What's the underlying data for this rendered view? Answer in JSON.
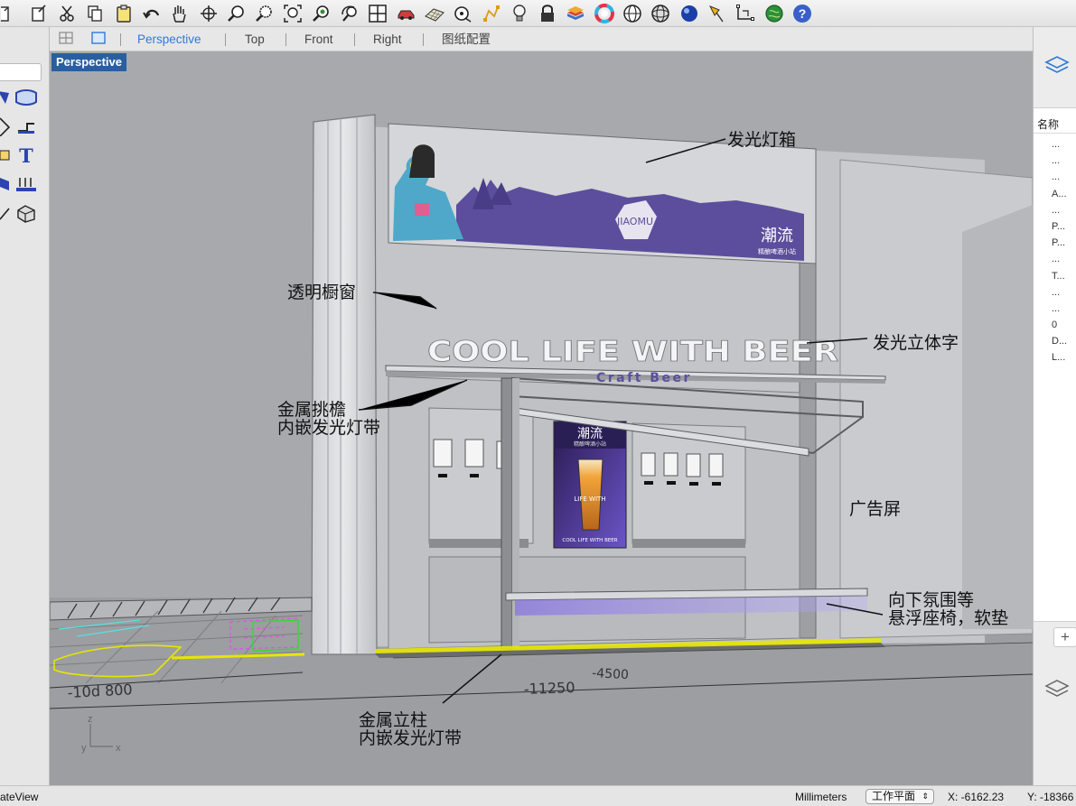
{
  "toolbar": {
    "icons": [
      "page-icon",
      "new-doc-icon",
      "cut-icon",
      "copy-icon",
      "paste-icon",
      "undo-icon",
      "pan-hand-icon",
      "rotate-view-icon",
      "zoom-icon",
      "zoom-window-icon",
      "zoom-extents-icon",
      "zoom-selected-icon",
      "rotate-camera-icon",
      "four-viewports-icon",
      "car-icon",
      "grid-plane-icon",
      "target-icon",
      "points-icon",
      "light-bulb-icon",
      "lock-icon",
      "layers-book-icon",
      "color-wheel-icon",
      "sphere-wire-icon",
      "mesh-sphere-icon",
      "render-sphere-icon",
      "pen-icon",
      "gumball-icon",
      "globe-icon",
      "help-icon"
    ]
  },
  "view_tabs": {
    "items": [
      "Perspective",
      "Top",
      "Front",
      "Right",
      "图纸配置"
    ],
    "active": "Perspective"
  },
  "viewport": {
    "label": "Perspective",
    "axis": {
      "z": "z",
      "y": "y",
      "x": "x"
    },
    "dimensions": [
      "-10d 800",
      "-4500",
      "-11250"
    ]
  },
  "scene": {
    "logo_text": "潮流",
    "logo_subtext": "精酿啤酒小站",
    "emblem_text": "JIAOMU",
    "headline": "COOL LIFE WITH BEER",
    "subline": "Craft Beer",
    "screen_logo": "潮流",
    "screen_sub": "精酿啤酒小站",
    "screen_mid": "LIFE WITH",
    "screen_bottom": "COOL LIFE WITH BEER"
  },
  "annotations": {
    "lightbox": "发光灯箱",
    "window": "透明橱窗",
    "letters": "发光立体字",
    "canopy_1": "金属挑檐",
    "canopy_2": "内嵌发光灯带",
    "ad_screen": "广告屏",
    "seat_1": "向下氛围等",
    "seat_2": "悬浮座椅，软垫",
    "pillar_1": "金属立柱",
    "pillar_2": "内嵌发光灯带"
  },
  "layers_panel": {
    "header": "名称",
    "rows": [
      "...",
      "...",
      "...",
      "A...",
      "...",
      "P...",
      "P...",
      "...",
      "T...",
      "...",
      "...",
      "0",
      "D...",
      "L..."
    ],
    "add_label": "+"
  },
  "statusbar": {
    "left": "ateView",
    "units": "Millimeters",
    "cplane": "工作平面",
    "x": "X: -6162.23",
    "y": "Y: -18366"
  },
  "colors": {
    "viewport_bg": "#a7a9ac",
    "active_tab": "#2f7ad6",
    "label_bg": "#2a5f9e",
    "banner_purple": "#5c4e9c",
    "glow_yellow": "#e6e600",
    "glow_purple": "#7b67d6"
  }
}
